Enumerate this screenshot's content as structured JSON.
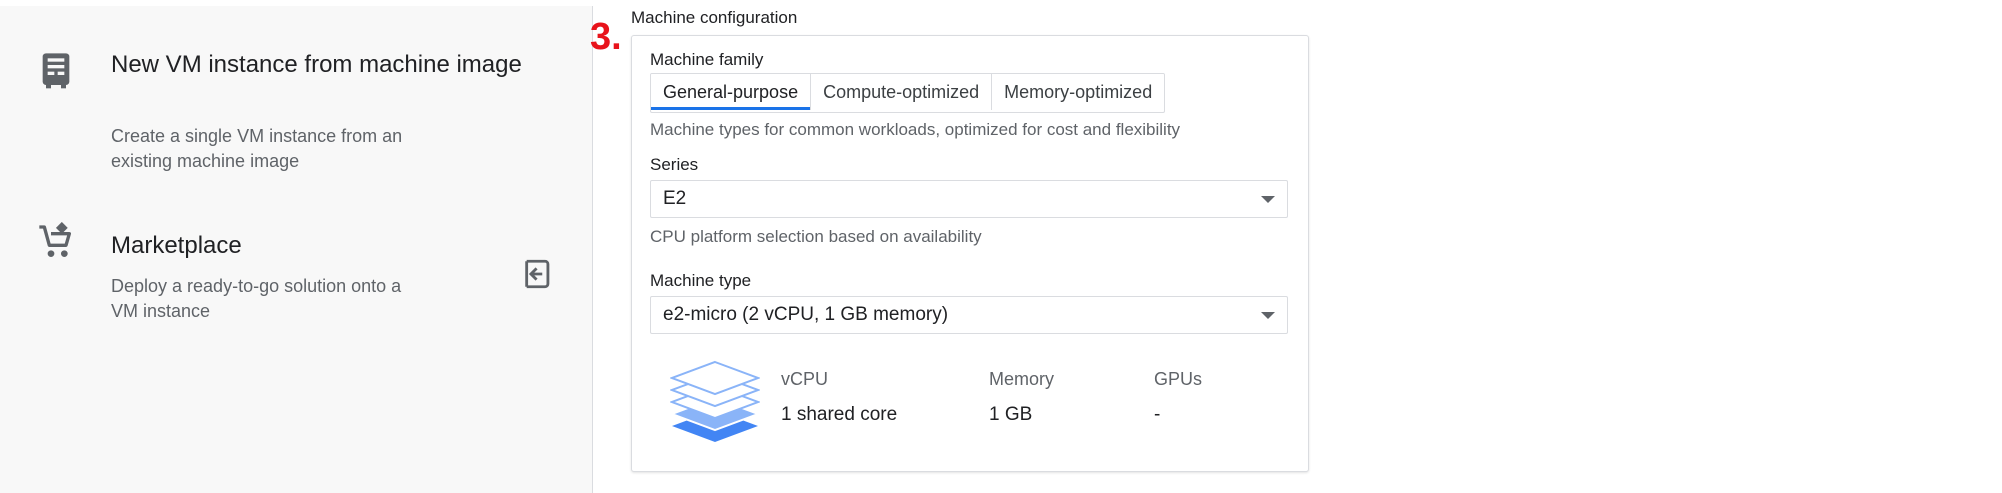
{
  "left_panel": {
    "options": [
      {
        "title": "New VM instance from machine image",
        "description": "Create a single VM instance from an existing machine image",
        "icon": "machine-image-icon"
      },
      {
        "title": "Marketplace",
        "description": "Deploy a ready-to-go solution onto a VM instance",
        "icon": "cart-icon"
      }
    ],
    "side_icon": "exit-panel-icon"
  },
  "step": {
    "number": "3."
  },
  "machine_configuration": {
    "section_title": "Machine configuration",
    "family": {
      "label": "Machine family",
      "tabs": [
        "General-purpose",
        "Compute-optimized",
        "Memory-optimized"
      ],
      "selected": "General-purpose",
      "help": "Machine types for common workloads, optimized for cost and flexibility"
    },
    "series": {
      "label": "Series",
      "value": "E2",
      "help": "CPU platform selection based on availability"
    },
    "machine_type": {
      "label": "Machine type",
      "value": "e2-micro (2 vCPU, 1 GB memory)"
    },
    "specs": {
      "icon": "stack-layers-icon",
      "columns": [
        {
          "header": "vCPU",
          "value": "1 shared core"
        },
        {
          "header": "Memory",
          "value": "1 GB"
        },
        {
          "header": "GPUs",
          "value": "-"
        }
      ]
    }
  },
  "colors": {
    "accent": "#1a73e8",
    "step_red": "#e8131b",
    "panel_bg": "#f8f8f8",
    "muted_text": "#5f6368"
  }
}
